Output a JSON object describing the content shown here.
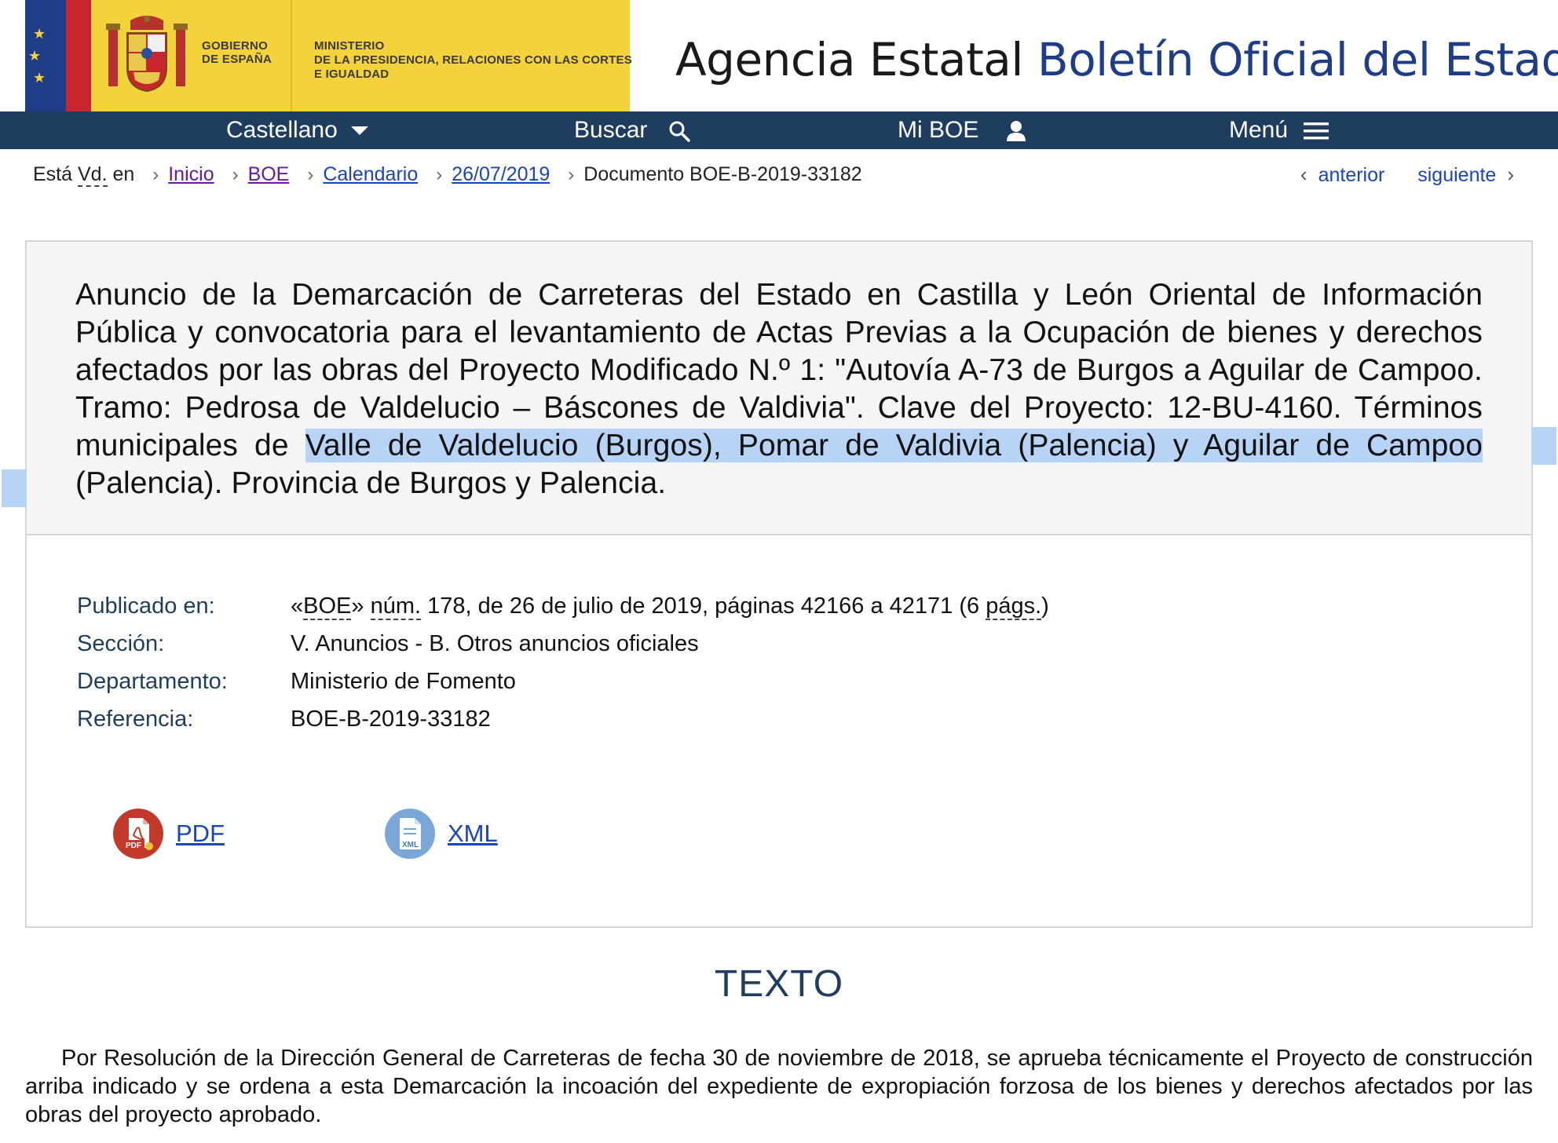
{
  "header": {
    "gov_line1": "GOBIERNO",
    "gov_line2": "DE ESPAÑA",
    "min_line1": "MINISTERIO",
    "min_line2": "DE LA PRESIDENCIA, RELACIONES CON LAS CORTES",
    "min_line3": "E IGUALDAD",
    "agency_part1": "Agencia Estatal ",
    "agency_part2": "Boletín Oficial del Estado"
  },
  "nav": {
    "language": "Castellano",
    "search": "Buscar",
    "my_boe": "Mi BOE",
    "menu": "Menú"
  },
  "breadcrumb": {
    "prefix_a": "Está ",
    "prefix_abbr": "Vd.",
    "prefix_b": " en",
    "items": [
      "Inicio",
      "BOE",
      "Calendario",
      "26/07/2019"
    ],
    "current": "Documento BOE-B-2019-33182"
  },
  "pager": {
    "prev": "anterior",
    "next": "siguiente"
  },
  "document": {
    "title_a": "Anuncio de la Demarcación de Carreteras del Estado en Castilla y León Oriental de Información Pública y convocatoria para el levantamiento de Actas Previas a la Ocupación de bienes y derechos afectados por las obras del Proyecto Modificado N.º 1: \"Autovía A-73 de Burgos a Aguilar de Campoo. Tramo: Pedrosa de Valdelucio – Báscones de Valdivia\". Clave del Proyecto: 12-BU-4160. Términos municipales de ",
    "title_highlight": "Valle de Valdelucio (Burgos), Pomar de Valdivia (Palencia) y Aguilar de Campoo",
    "title_b": " (Palencia). Provincia de Burgos y Palencia.",
    "meta": {
      "published_label": "Publicado en:",
      "published_q1": "«",
      "published_boe": "BOE",
      "published_q2": "» ",
      "published_num": "núm.",
      "published_mid": " 178, de 26 de julio de 2019, páginas 42166 a 42171 (6 ",
      "published_pags": "págs.",
      "published_end": ")",
      "section_label": "Sección:",
      "section_value": "V. Anuncios - B. Otros anuncios oficiales",
      "dept_label": "Departamento:",
      "dept_value": "Ministerio de Fomento",
      "ref_label": "Referencia:",
      "ref_value": "BOE-B-2019-33182"
    },
    "downloads": {
      "pdf": "PDF",
      "xml": "XML",
      "pdf_icon_text": "PDF",
      "xml_icon_text": "XML"
    }
  },
  "text_section": {
    "heading": "TEXTO",
    "paragraph": "Por Resolución de la Dirección General de Carreteras de fecha 30 de noviembre de 2018, se aprueba técnicamente el Proyecto de construcción arriba indicado y se ordena a esta Demarcación la incoación del expediente de expropiación forzosa de los bienes y derechos afectados por las obras del proyecto aprobado."
  },
  "colors": {
    "navy": "#1f3d5f",
    "gov_yellow": "#f4d23c",
    "link": "#1b46b8",
    "highlight": "#b7d4f7",
    "pdf_red": "#c0392b",
    "xml_blue": "#7aa7d8"
  }
}
